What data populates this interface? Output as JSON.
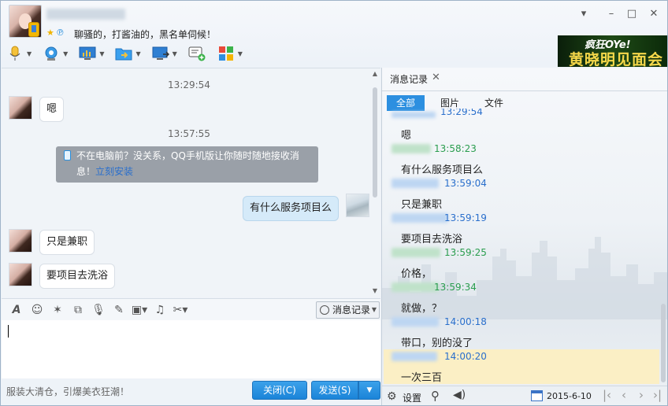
{
  "header": {
    "signature": "聊骚的，打酱油的，黑名单伺候！",
    "window_controls": [
      "▾",
      "–",
      "□",
      "✕"
    ],
    "banner": {
      "top_text": "疯狂OYe!",
      "main_text": "黄晓明见面会"
    }
  },
  "toolbar": {
    "items": [
      {
        "name": "voice-call",
        "icon": "microphone-icon"
      },
      {
        "name": "video-call",
        "icon": "webcam-icon"
      },
      {
        "name": "remote-desktop",
        "icon": "screen-share-icon"
      },
      {
        "name": "send-file",
        "icon": "folder-arrow-icon"
      },
      {
        "name": "remote-assist",
        "icon": "monitor-arrow-icon"
      },
      {
        "name": "create-discussion",
        "icon": "chat-add-icon"
      },
      {
        "name": "apps",
        "icon": "apps-grid-icon"
      }
    ]
  },
  "chat": {
    "time1": "13:29:54",
    "msg1": "嗯",
    "time2": "13:57:55",
    "notice_text": "不在电脑前？没关系，QQ手机版让你随时随地接收消息！",
    "notice_link": "立刻安装",
    "msg_me": "有什么服务项目么",
    "msg2": "只是兼职",
    "msg3": "要项目去洗浴"
  },
  "input_toolbar": {
    "history_label": "消息记录"
  },
  "footer": {
    "ad_text": "服装大清仓，引爆美衣狂潮！",
    "close_label": "关闭(C)",
    "send_label": "发送(S)"
  },
  "history": {
    "tab_label": "消息记录",
    "filters": [
      "全部",
      "图片",
      "文件"
    ],
    "partial_top": "13:29:54",
    "entries": [
      {
        "text": "嗯",
        "time": "13:58:23",
        "from": "them"
      },
      {
        "text": "有什么服务项目么",
        "time": "13:59:04",
        "from": "me"
      },
      {
        "text": "只是兼职",
        "time": "13:59:19",
        "from": "me"
      },
      {
        "text": "要项目去洗浴",
        "time": "13:59:25",
        "from": "them"
      },
      {
        "text": "价格，",
        "time": "13:59:34",
        "from": "them"
      },
      {
        "text": "就做，？",
        "time": "14:00:18",
        "from": "me"
      },
      {
        "text": "带口，别的没了",
        "time": "14:00:20",
        "from": "me"
      },
      {
        "text": "一次三百",
        "time": "",
        "from": "me"
      }
    ],
    "settings_label": "设置",
    "date": "2015-6-10"
  },
  "colors": {
    "accent": "#2c8fe0",
    "time_them": "#2a9d4e",
    "time_me": "#2a6fcc",
    "highlight": "#fbefc5"
  }
}
